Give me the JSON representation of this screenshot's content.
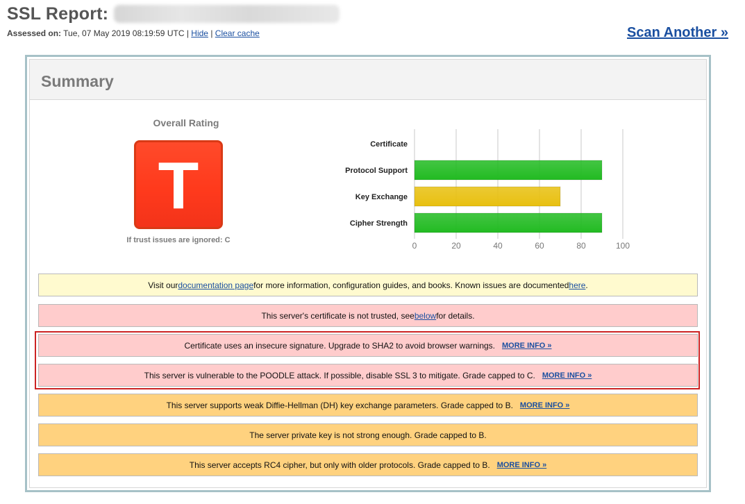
{
  "header": {
    "title": "SSL Report:",
    "assessed_label": "Assessed on:",
    "assessed_value": "Tue, 07 May 2019 08:19:59 UTC",
    "sep1": "|",
    "hide_link": "Hide",
    "sep2": "|",
    "clear_cache_link": "Clear cache",
    "scan_another": "Scan Another »"
  },
  "summary": {
    "title": "Summary",
    "overall_rating_label": "Overall Rating",
    "grade": "T",
    "trust_note": "If trust issues are ignored: C"
  },
  "chart_data": {
    "type": "bar",
    "orientation": "horizontal",
    "categories": [
      "Certificate",
      "Protocol Support",
      "Key Exchange",
      "Cipher Strength"
    ],
    "values": [
      0,
      90,
      70,
      90
    ],
    "colors": [
      "#22bb22",
      "#22bb22",
      "#e8c010",
      "#22bb22"
    ],
    "xlim": [
      0,
      100
    ],
    "xticks": [
      "0",
      "20",
      "40",
      "60",
      "80",
      "100"
    ],
    "grid": true
  },
  "notices": {
    "doc": {
      "pre": "Visit our ",
      "link": "documentation page",
      "mid": " for more information, configuration guides, and books. Known issues are documented ",
      "link2": "here",
      "post": "."
    },
    "cert": {
      "pre": "This server's certificate is not trusted, see ",
      "link": "below",
      "post": " for details."
    },
    "sha2": {
      "text": "Certificate uses an insecure signature. Upgrade to SHA2 to avoid browser warnings.",
      "more": "MORE INFO »"
    },
    "poodle": {
      "text": "This server is vulnerable to the POODLE attack. If possible, disable SSL 3 to mitigate. Grade capped to C.",
      "more": "MORE INFO »"
    },
    "dh": {
      "text": "This server supports weak Diffie-Hellman (DH) key exchange parameters. Grade capped to B.",
      "more": "MORE INFO »"
    },
    "key": {
      "text": "The server private key is not strong enough. Grade capped to B."
    },
    "rc4": {
      "text": "This server accepts RC4 cipher, but only with older protocols. Grade capped to B.",
      "more": "MORE INFO »"
    }
  }
}
